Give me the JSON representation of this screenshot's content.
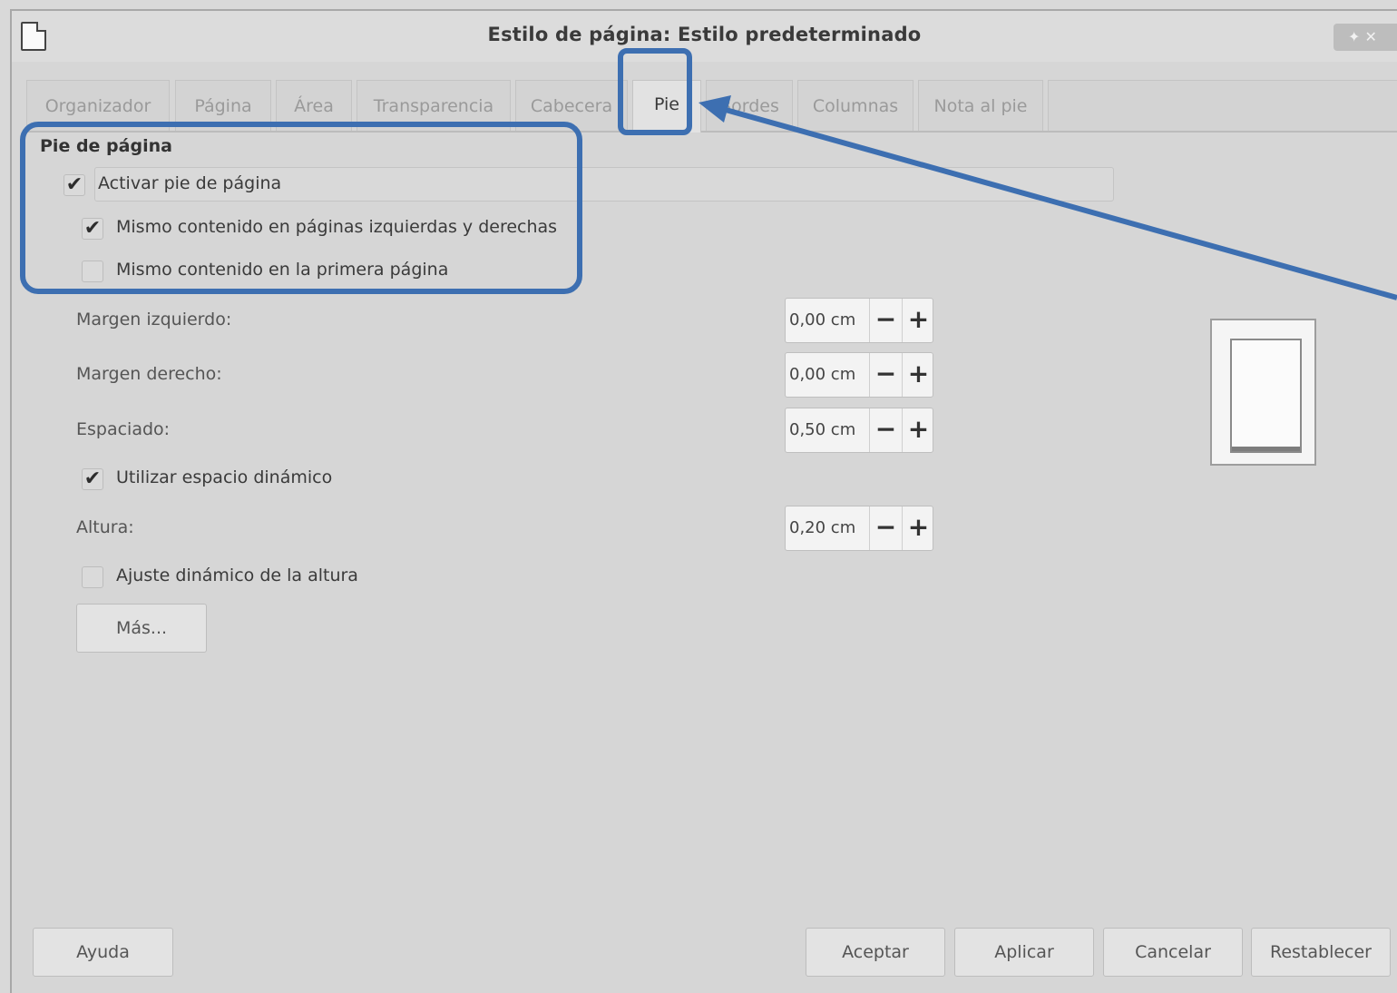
{
  "window": {
    "title": "Estilo de página: Estilo predeterminado",
    "wm_buttons": "✦ ✕"
  },
  "tabs": [
    {
      "label": "Organizador",
      "active": false
    },
    {
      "label": "Página",
      "active": false
    },
    {
      "label": "Área",
      "active": false
    },
    {
      "label": "Transparencia",
      "active": false
    },
    {
      "label": "Cabecera",
      "active": false
    },
    {
      "label": "Pie",
      "active": true
    },
    {
      "label": "Bordes",
      "active": false
    },
    {
      "label": "Columnas",
      "active": false
    },
    {
      "label": "Nota al pie",
      "active": false
    }
  ],
  "footer_section": {
    "title": "Pie de página",
    "enable": {
      "label": "Activar pie de página",
      "checked": true
    },
    "same_left_right": {
      "label": "Mismo contenido en páginas izquierdas y derechas",
      "checked": true
    },
    "same_first_page": {
      "label": "Mismo contenido en la primera página",
      "checked": false
    }
  },
  "fields": {
    "left_margin": {
      "label": "Margen izquierdo:",
      "value": "0,00 cm"
    },
    "right_margin": {
      "label": "Margen derecho:",
      "value": "0,00 cm"
    },
    "spacing": {
      "label": "Espaciado:",
      "value": "0,50 cm"
    },
    "dynamic_spacing": {
      "label": "Utilizar espacio dinámico",
      "checked": true
    },
    "height": {
      "label": "Altura:",
      "value": "0,20 cm"
    },
    "autofit_height": {
      "label": "Ajuste dinámico de la altura",
      "checked": false
    }
  },
  "spin_glyphs": {
    "minus": "−",
    "plus": "+"
  },
  "checkmark": "✔",
  "buttons": {
    "more": "Más...",
    "help": "Ayuda",
    "ok": "Aceptar",
    "apply": "Aplicar",
    "cancel": "Cancelar",
    "reset": "Restablecer"
  },
  "colors": {
    "annotation": "#3d6fb1",
    "dialog_bg": "#d6d6d6"
  }
}
